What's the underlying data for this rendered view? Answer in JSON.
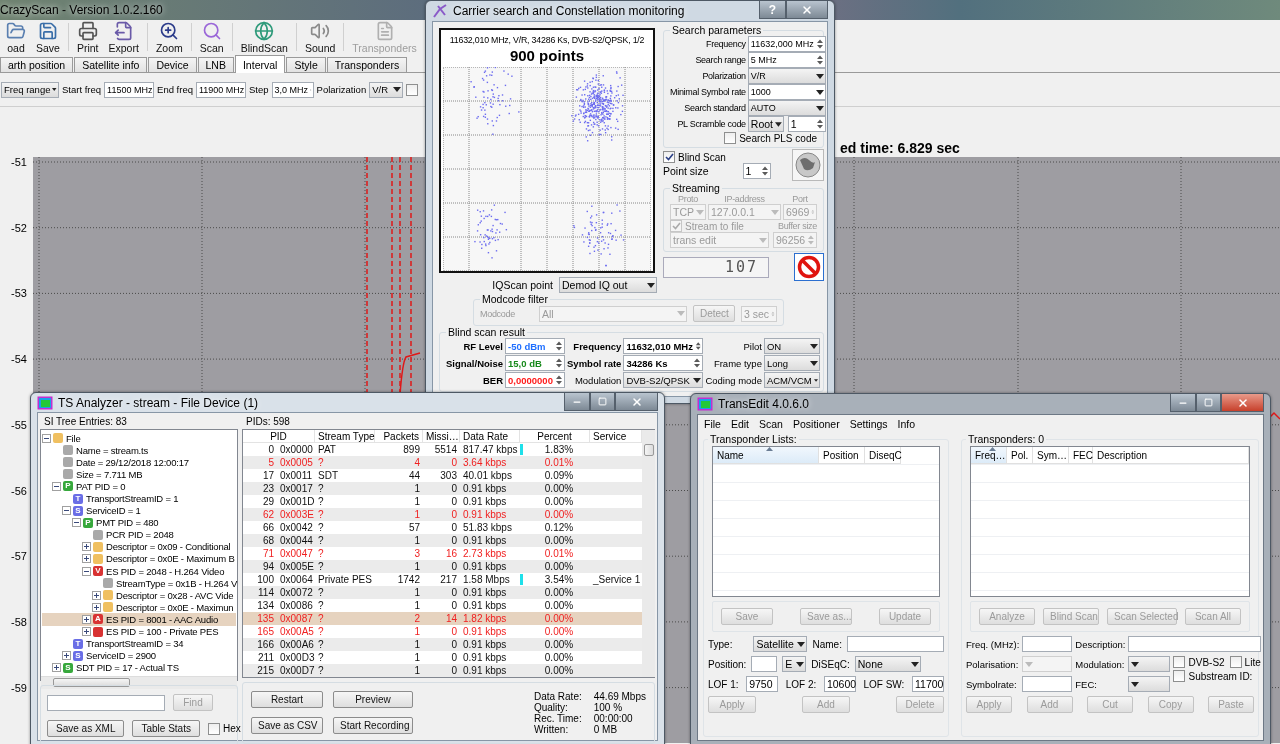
{
  "main_window": {
    "title": "CrazyScan - Version 1.0.2.160",
    "toolbar": [
      {
        "label": "oad",
        "disabled": false
      },
      {
        "label": "Save",
        "disabled": false
      },
      {
        "label": "Print",
        "disabled": false
      },
      {
        "label": "Export",
        "disabled": false
      },
      {
        "label": "Zoom",
        "disabled": false
      },
      {
        "label": "Scan",
        "disabled": false
      },
      {
        "label": "BlindScan",
        "disabled": false
      },
      {
        "label": "Sound",
        "disabled": false
      },
      {
        "label": "Transponders",
        "disabled": true
      }
    ],
    "tabs": [
      {
        "label": "arth position",
        "selected": false
      },
      {
        "label": "Satellite info",
        "selected": false
      },
      {
        "label": "Device",
        "selected": false
      },
      {
        "label": "LNB",
        "selected": false
      },
      {
        "label": "Interval",
        "selected": true
      },
      {
        "label": "Style",
        "selected": false
      },
      {
        "label": "Transponders",
        "selected": false
      }
    ],
    "interval": {
      "mode": "Freq range",
      "fields": [
        {
          "label": "Start freq",
          "value": "11500 MHz"
        },
        {
          "label": "End freq",
          "value": "11900 MHz"
        },
        {
          "label": "Step",
          "value": "3,0 MHz"
        }
      ],
      "polarization_label": "Polarization",
      "polarization": "V/R",
      "option_checked": false
    },
    "elapsed": "ed time: 6.829 sec",
    "y_axis_labels": [
      "-51",
      "-52",
      "-53",
      "-54",
      "-55",
      "-56",
      "-57",
      "-58",
      "-59"
    ]
  },
  "carrier_window": {
    "title": "Carrier search and Constellation monitoring",
    "help": "?",
    "constellation": {
      "caption": "11632,010 MHz, V/R, 34286 Ks, DVB-S2/QPSK, 1/2",
      "points": "900 points"
    },
    "search_parameters": {
      "title": "Search parameters",
      "rows": [
        {
          "label": "Frequency",
          "value": "11632,000 MHz",
          "kind": "spin"
        },
        {
          "label": "Search range",
          "value": "5 MHz",
          "kind": "spin"
        },
        {
          "label": "Polarization",
          "value": "V/R",
          "kind": "select"
        },
        {
          "label": "Minimal Symbol rate",
          "value": "1000",
          "kind": "combo"
        },
        {
          "label": "Search standard",
          "value": "AUTO",
          "kind": "select"
        }
      ],
      "pl_scramble": {
        "label": "PL Scramble code",
        "mode": "Root",
        "value": "1"
      },
      "search_pls": {
        "label": "Search PLS code",
        "checked": false
      }
    },
    "blind_scan": {
      "label": "Blind Scan",
      "checked": true
    },
    "point_size": {
      "label": "Point size",
      "value": "1"
    },
    "streaming": {
      "title": "Streaming",
      "disabled": true,
      "headers": [
        "Proto",
        "IP-address",
        "Port"
      ],
      "proto": "TCP",
      "ip": "127.0.0.1",
      "port": "6969",
      "stream_to_file": {
        "label": "Stream to file",
        "checked": true
      },
      "buffer_label": "Buffer size",
      "target": "trans edit",
      "buffer": "96256"
    },
    "iq_label": "IQScan point",
    "iq_value": "Demod IQ out",
    "counter": "107",
    "modcode_filter": {
      "title": "Modcode filter",
      "disabled": true,
      "label": "Modcode",
      "value": "All",
      "detect": "Detect",
      "timeout": "3 sec"
    },
    "result": {
      "title": "Blind scan result",
      "left": [
        {
          "label": "RF Level",
          "value": "-50 dBm",
          "color": "#1f6fff"
        },
        {
          "label": "Signal/Noise",
          "value": "15,0 dB",
          "color": "#16891a"
        },
        {
          "label": "BER",
          "value": "0,0000000",
          "color": "#ff1a1a"
        }
      ],
      "middle": [
        {
          "label": "Frequency",
          "value": "11632,010 MHz",
          "kind": "spin"
        },
        {
          "label": "Symbol rate",
          "value": "34286 Ks",
          "kind": "spin"
        },
        {
          "label": "Modulation",
          "value": "DVB-S2/QPSK",
          "kind": "select"
        }
      ],
      "right": [
        {
          "label": "Pilot",
          "value": "ON"
        },
        {
          "label": "Frame type",
          "value": "Long"
        },
        {
          "label": "Coding mode",
          "value": "ACM/VCM"
        }
      ]
    }
  },
  "ts_analyzer": {
    "title": "TS Analyzer - stream - File Device (1)",
    "tree_title": "SI Tree Entries: 83",
    "tree": [
      {
        "label": "File",
        "color": "#f0c060",
        "expanded": true,
        "selected": false,
        "children": [
          {
            "label": "Name = stream.ts",
            "color": "#a9a9a9",
            "selected": false
          },
          {
            "label": "Date = 29/12/2018 12:00:17",
            "color": "#a9a9a9",
            "selected": false
          },
          {
            "label": "Size = 7.711 MB",
            "color": "#a9a9a9",
            "selected": false
          },
          {
            "label": "PAT PID = 0",
            "badge": "P",
            "color": "#37a83c",
            "expanded": true,
            "selected": false,
            "children": [
              {
                "label": "TransportStreamID = 1",
                "badge": "T",
                "color": "#6a6ee6",
                "selected": false
              },
              {
                "label": "ServiceID = 1",
                "badge": "S",
                "color": "#6a6ee6",
                "expanded": true,
                "selected": false,
                "children": [
                  {
                    "label": "PMT PID = 480",
                    "badge": "P",
                    "color": "#37a83c",
                    "expanded": true,
                    "selected": false,
                    "children": [
                      {
                        "label": "PCR PID = 2048",
                        "color": "#a9a9a9",
                        "selected": false
                      },
                      {
                        "label": "Descriptor = 0x09 - Conditional",
                        "color": "#f0c060",
                        "expanded": false,
                        "selected": false
                      },
                      {
                        "label": "Descriptor = 0x0E - Maximum B",
                        "color": "#f0c060",
                        "expanded": false,
                        "selected": false
                      },
                      {
                        "label": "ES PID = 2048 - H.264 Video",
                        "badge": "V",
                        "color": "#d83232",
                        "expanded": true,
                        "selected": false,
                        "children": [
                          {
                            "label": "StreamType = 0x1B - H.264 V",
                            "color": "#a9a9a9",
                            "selected": false
                          },
                          {
                            "label": "Descriptor = 0x28 - AVC Vide",
                            "color": "#f0c060",
                            "expanded": false,
                            "selected": false
                          },
                          {
                            "label": "Descriptor = 0x0E - Maximun",
                            "color": "#f0c060",
                            "expanded": false,
                            "selected": false
                          }
                        ]
                      },
                      {
                        "label": "ES PID = 8001 - AAC Audio",
                        "badge": "A",
                        "color": "#d83232",
                        "expanded": false,
                        "selected": true
                      },
                      {
                        "label": "ES PID = 100 - Private PES",
                        "color": "#d83232",
                        "expanded": false,
                        "selected": false
                      }
                    ]
                  }
                ]
              },
              {
                "label": "TransportStreamID = 34",
                "badge": "T",
                "color": "#6a6ee6",
                "selected": false
              },
              {
                "label": "ServiceID = 2900",
                "badge": "S",
                "color": "#6a6ee6",
                "expanded": false,
                "selected": false
              }
            ]
          },
          {
            "label": "SDT PID = 17 - Actual TS",
            "badge": "S",
            "color": "#37a83c",
            "expanded": false,
            "selected": false
          }
        ]
      }
    ],
    "find_button": {
      "label": "Find",
      "disabled": true
    },
    "tree_buttons": [
      "Save as XML",
      "Table Stats"
    ],
    "hex": {
      "label": "Hex",
      "checked": false
    },
    "table_title": "PIDs: 598",
    "columns": [
      "PID",
      "Stream Type",
      "Packets",
      "Missi…",
      "Data Rate",
      "Percent",
      "Service"
    ],
    "rows": [
      {
        "pid": "0",
        "hex": "0x0000",
        "type": "PAT",
        "packets": "899",
        "missing": "5514",
        "rate": "817.47 kbps",
        "marker": true,
        "percent": "1.83%",
        "error": false,
        "selected": false
      },
      {
        "pid": "5",
        "hex": "0x0005",
        "type": "?",
        "packets": "4",
        "missing": "0",
        "rate": "3.64 kbps",
        "percent": "0.01%",
        "error": true,
        "selected": false
      },
      {
        "pid": "17",
        "hex": "0x0011",
        "type": "SDT",
        "packets": "44",
        "missing": "303",
        "rate": "40.01 kbps",
        "percent": "0.09%",
        "error": false,
        "selected": false
      },
      {
        "pid": "23",
        "hex": "0x0017",
        "type": "?",
        "packets": "1",
        "missing": "0",
        "rate": "0.91 kbps",
        "percent": "0.00%",
        "error": false,
        "selected": false
      },
      {
        "pid": "29",
        "hex": "0x001D",
        "type": "?",
        "packets": "1",
        "missing": "0",
        "rate": "0.91 kbps",
        "percent": "0.00%",
        "error": false,
        "selected": false
      },
      {
        "pid": "62",
        "hex": "0x003E",
        "type": "?",
        "packets": "1",
        "missing": "0",
        "rate": "0.91 kbps",
        "percent": "0.00%",
        "error": true,
        "selected": false
      },
      {
        "pid": "66",
        "hex": "0x0042",
        "type": "?",
        "packets": "57",
        "missing": "0",
        "rate": "51.83 kbps",
        "percent": "0.12%",
        "error": false,
        "selected": false
      },
      {
        "pid": "68",
        "hex": "0x0044",
        "type": "?",
        "packets": "1",
        "missing": "0",
        "rate": "0.91 kbps",
        "percent": "0.00%",
        "error": false,
        "selected": false
      },
      {
        "pid": "71",
        "hex": "0x0047",
        "type": "?",
        "packets": "3",
        "missing": "16",
        "rate": "2.73 kbps",
        "percent": "0.01%",
        "error": true,
        "selected": false
      },
      {
        "pid": "94",
        "hex": "0x005E",
        "type": "?",
        "packets": "1",
        "missing": "0",
        "rate": "0.91 kbps",
        "percent": "0.00%",
        "error": false,
        "selected": false
      },
      {
        "pid": "100",
        "hex": "0x0064",
        "type": "Private PES",
        "packets": "1742",
        "missing": "217",
        "rate": "1.58 Mbps",
        "marker": true,
        "percent": "3.54%",
        "service": "_Service 1",
        "error": false,
        "selected": false
      },
      {
        "pid": "114",
        "hex": "0x0072",
        "type": "?",
        "packets": "1",
        "missing": "0",
        "rate": "0.91 kbps",
        "percent": "0.00%",
        "error": false,
        "selected": false
      },
      {
        "pid": "134",
        "hex": "0x0086",
        "type": "?",
        "packets": "1",
        "missing": "0",
        "rate": "0.91 kbps",
        "percent": "0.00%",
        "error": false,
        "selected": false
      },
      {
        "pid": "135",
        "hex": "0x0087",
        "type": "?",
        "packets": "2",
        "missing": "14",
        "rate": "1.82 kbps",
        "percent": "0.00%",
        "error": true,
        "selected": true
      },
      {
        "pid": "165",
        "hex": "0x00A5",
        "type": "?",
        "packets": "1",
        "missing": "0",
        "rate": "0.91 kbps",
        "percent": "0.00%",
        "error": true,
        "selected": false
      },
      {
        "pid": "166",
        "hex": "0x00A6",
        "type": "?",
        "packets": "1",
        "missing": "0",
        "rate": "0.91 kbps",
        "percent": "0.00%",
        "error": false,
        "selected": false
      },
      {
        "pid": "211",
        "hex": "0x00D3",
        "type": "?",
        "packets": "1",
        "missing": "0",
        "rate": "0.91 kbps",
        "percent": "0.00%",
        "error": false,
        "selected": false
      },
      {
        "pid": "215",
        "hex": "0x00D7",
        "type": "?",
        "packets": "1",
        "missing": "0",
        "rate": "0.91 kbps",
        "percent": "0.00%",
        "error": false,
        "selected": false
      }
    ],
    "buttons": [
      "Restart",
      "Preview",
      "Save as CSV",
      "Start Recording"
    ],
    "stats": [
      {
        "label": "Data Rate:",
        "value": "44.69 Mbps"
      },
      {
        "label": "Quality:",
        "value": "100 %"
      },
      {
        "label": "Rec. Time:",
        "value": "00:00:00"
      },
      {
        "label": "Written:",
        "value": "0 MB"
      }
    ]
  },
  "transedit": {
    "title": "TransEdit 4.0.6.0",
    "menu": [
      "File",
      "Edit",
      "Scan",
      "Positioner",
      "Settings",
      "Info"
    ],
    "lists": {
      "title": "Transponder Lists:",
      "columns": [
        "Name",
        "Position",
        "DiseqC"
      ],
      "buttons": [
        {
          "label": "Save",
          "disabled": true
        },
        {
          "label": "Save as...",
          "disabled": true
        },
        {
          "label": "Update",
          "disabled": true
        }
      ]
    },
    "left_form": {
      "type_label": "Type:",
      "type": "Satellite",
      "name_label": "Name:",
      "position_label": "Position:",
      "direction": "E",
      "diseqc_label": "DiSEqC:",
      "diseqc": "None",
      "lof": [
        {
          "label": "LOF 1:",
          "value": "9750"
        },
        {
          "label": "LOF 2:",
          "value": "10600"
        },
        {
          "label": "LOF SW:",
          "value": "11700"
        }
      ],
      "buttons": [
        {
          "label": "Apply",
          "disabled": true
        },
        {
          "label": "Add",
          "disabled": true
        },
        {
          "label": "Delete",
          "disabled": true
        }
      ]
    },
    "transponders": {
      "title": "Transponders: 0",
      "columns": [
        "Freq…",
        "Pol.",
        "Sym…",
        "FEC",
        "Description"
      ],
      "buttons": [
        {
          "label": "Analyze",
          "disabled": true
        },
        {
          "label": "Blind Scan",
          "disabled": true
        },
        {
          "label": "Scan Selected",
          "disabled": true
        },
        {
          "label": "Scan All",
          "disabled": true
        }
      ]
    },
    "right_form": {
      "freq_label": "Freq. (MHz):",
      "description_label": "Description:",
      "polarisation_label": "Polarisation:",
      "polarisation_disabled": true,
      "modulation_label": "Modulation:",
      "symbolrate_label": "Symbolrate:",
      "fec_label": "FEC:",
      "checks": [
        {
          "label": "DVB-S2",
          "checked": false
        },
        {
          "label": "Lite",
          "checked": false
        },
        {
          "label": "Substream ID:",
          "checked": false
        }
      ],
      "buttons": [
        {
          "label": "Apply",
          "disabled": true
        },
        {
          "label": "Add",
          "disabled": true
        },
        {
          "label": "Cut",
          "disabled": true
        },
        {
          "label": "Copy",
          "disabled": true
        },
        {
          "label": "Paste",
          "disabled": true
        }
      ]
    }
  }
}
